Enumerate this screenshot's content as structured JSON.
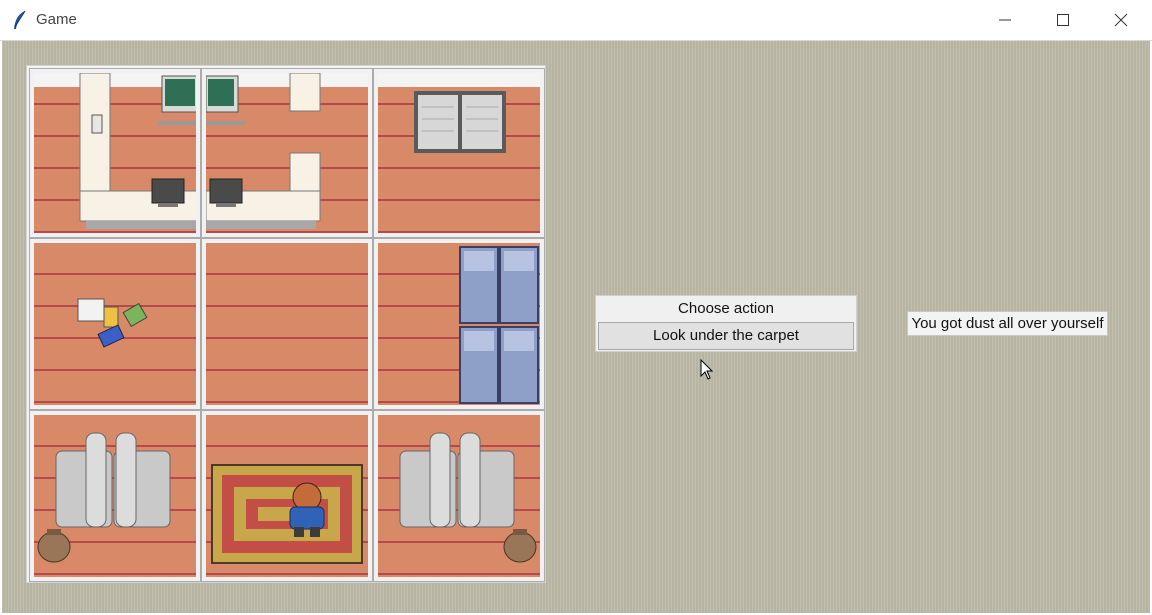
{
  "window": {
    "title": "Game",
    "app_icon": "feather-icon",
    "controls": [
      "minimize-icon",
      "maximize-icon",
      "close-icon"
    ]
  },
  "board": {
    "rows": 3,
    "cols": 3,
    "floor_color": "#d88a68",
    "stripe_color": "#b54b48",
    "tiles": [
      {
        "name": "tile-desk-left",
        "content": [
          "desk",
          "computer-monitor-icon",
          "chalkboard-icon"
        ]
      },
      {
        "name": "tile-desk-right",
        "content": [
          "desk",
          "computer-monitor-icon",
          "chalkboard-icon"
        ]
      },
      {
        "name": "tile-window",
        "content": [
          "window-icon"
        ]
      },
      {
        "name": "tile-scattered-books",
        "content": [
          "books-icon"
        ]
      },
      {
        "name": "tile-empty",
        "content": []
      },
      {
        "name": "tile-lockers",
        "content": [
          "locker-icon"
        ]
      },
      {
        "name": "tile-sofa-left",
        "content": [
          "armchair-icon",
          "pot-icon"
        ]
      },
      {
        "name": "tile-carpet-player",
        "content": [
          "carpet",
          "player-icon"
        ]
      },
      {
        "name": "tile-sofa-right",
        "content": [
          "armchair-icon",
          "pot-icon"
        ]
      }
    ]
  },
  "actions": {
    "label": "Choose action",
    "selected": "Look under the carpet"
  },
  "message": "You got dust all over yourself"
}
